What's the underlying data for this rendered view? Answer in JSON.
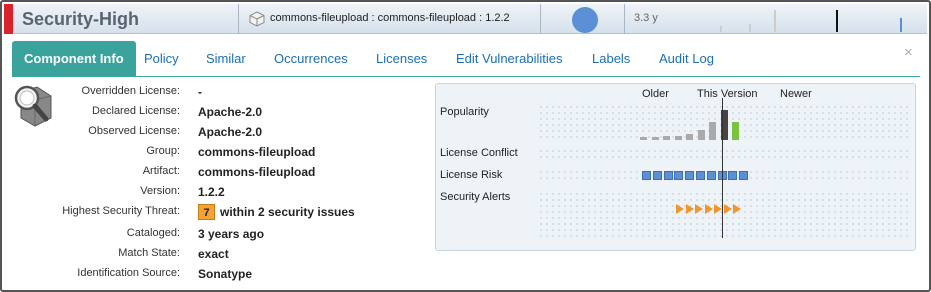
{
  "header": {
    "threat_title": "Security-High",
    "coordinates": "commons-fileupload : commons-fileupload : 1.2.2",
    "age": "3.3 y",
    "colors": {
      "threat": "#d8232a",
      "age_bubble": "#5b8fd6"
    }
  },
  "tabs": [
    {
      "label": "Component Info",
      "active": true
    },
    {
      "label": "Policy"
    },
    {
      "label": "Similar"
    },
    {
      "label": "Occurrences"
    },
    {
      "label": "Licenses"
    },
    {
      "label": "Edit Vulnerabilities"
    },
    {
      "label": "Labels"
    },
    {
      "label": "Audit Log"
    }
  ],
  "close_icon": "×",
  "details": [
    {
      "label": "Overridden License:",
      "value": "-"
    },
    {
      "label": "Declared License:",
      "value": "Apache-2.0"
    },
    {
      "label": "Observed License:",
      "value": "Apache-2.0"
    },
    {
      "label": "Group:",
      "value": "commons-fileupload"
    },
    {
      "label": "Artifact:",
      "value": "commons-fileupload"
    },
    {
      "label": "Version:",
      "value": "1.2.2"
    },
    {
      "label": "Highest Security Threat:",
      "badge": "7",
      "value": "within 2 security issues"
    },
    {
      "label": "Cataloged:",
      "value": "3 years ago"
    },
    {
      "label": "Match State:",
      "value": "exact"
    },
    {
      "label": "Identification Source:",
      "value": "Sonatype"
    }
  ],
  "graph": {
    "headers": {
      "older": "Older",
      "this_version": "This Version",
      "newer": "Newer"
    },
    "rows": {
      "popularity": "Popularity",
      "license_conflict": "License Conflict",
      "license_risk": "License Risk",
      "security_alerts": "Security Alerts"
    },
    "popularity_levels": [
      0.1,
      0.1,
      0.13,
      0.13,
      0.2,
      0.33,
      0.6,
      1.0,
      0.6
    ],
    "popularity_colors": [
      "#aaa",
      "#aaa",
      "#aaa",
      "#aaa",
      "#aaa",
      "#aaa",
      "#aaa",
      "#444",
      "#7cc242"
    ],
    "license_risk_versions": 10,
    "security_alert_versions": 7
  }
}
